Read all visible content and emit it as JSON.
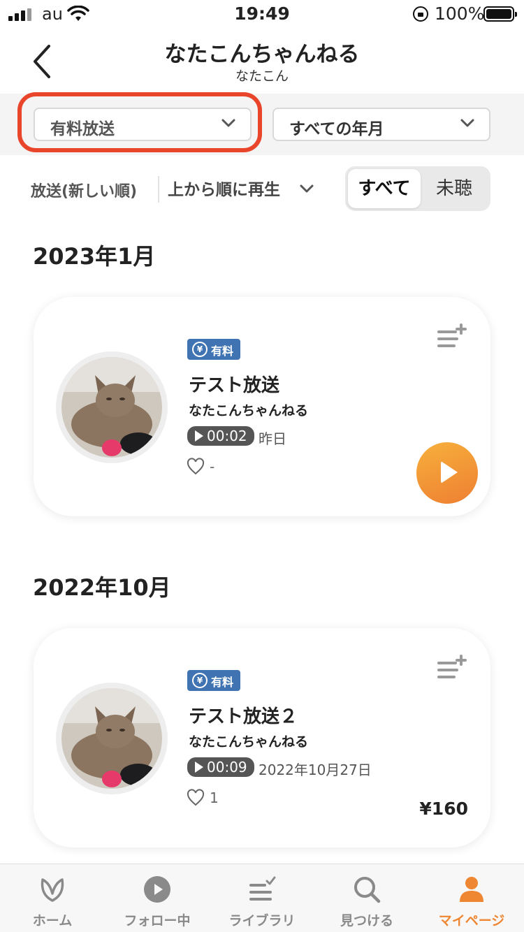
{
  "status_bar": {
    "carrier": "au",
    "time": "19:49",
    "battery": "100%"
  },
  "header": {
    "title": "なたこんちゃんねる",
    "subtitle": "なたこん"
  },
  "filters": {
    "type_dropdown": "有料放送",
    "date_dropdown": "すべての年月"
  },
  "sort": {
    "order_label": "放送(新しい順)",
    "play_mode": "上から順に再生",
    "segments": [
      "すべて",
      "未聴"
    ],
    "selected_segment": "すべて"
  },
  "sections": [
    {
      "month": "2023年1月",
      "episode": {
        "badge": "有料",
        "badge_symbol": "¥",
        "title": "テスト放送",
        "channel": "なたこんちゃんねる",
        "duration": "00:02",
        "date": "昨日",
        "likes": "-"
      }
    },
    {
      "month": "2022年10月",
      "episode": {
        "badge": "有料",
        "badge_symbol": "¥",
        "title": "テスト放送２",
        "channel": "なたこんちゃんねる",
        "duration": "00:09",
        "date": "2022年10月27日",
        "likes": "1",
        "price": "¥160"
      }
    }
  ],
  "tab_bar": {
    "items": [
      {
        "label": "ホーム",
        "icon": "leaf-icon"
      },
      {
        "label": "フォロー中",
        "icon": "play-circle-icon"
      },
      {
        "label": "ライブラリ",
        "icon": "library-check-icon"
      },
      {
        "label": "見つける",
        "icon": "search-icon"
      },
      {
        "label": "マイページ",
        "icon": "person-icon"
      }
    ],
    "active": "マイページ"
  },
  "colors": {
    "accent": "#ef8632",
    "paid_badge": "#3f73b2",
    "highlight_ring": "#e8452b"
  }
}
